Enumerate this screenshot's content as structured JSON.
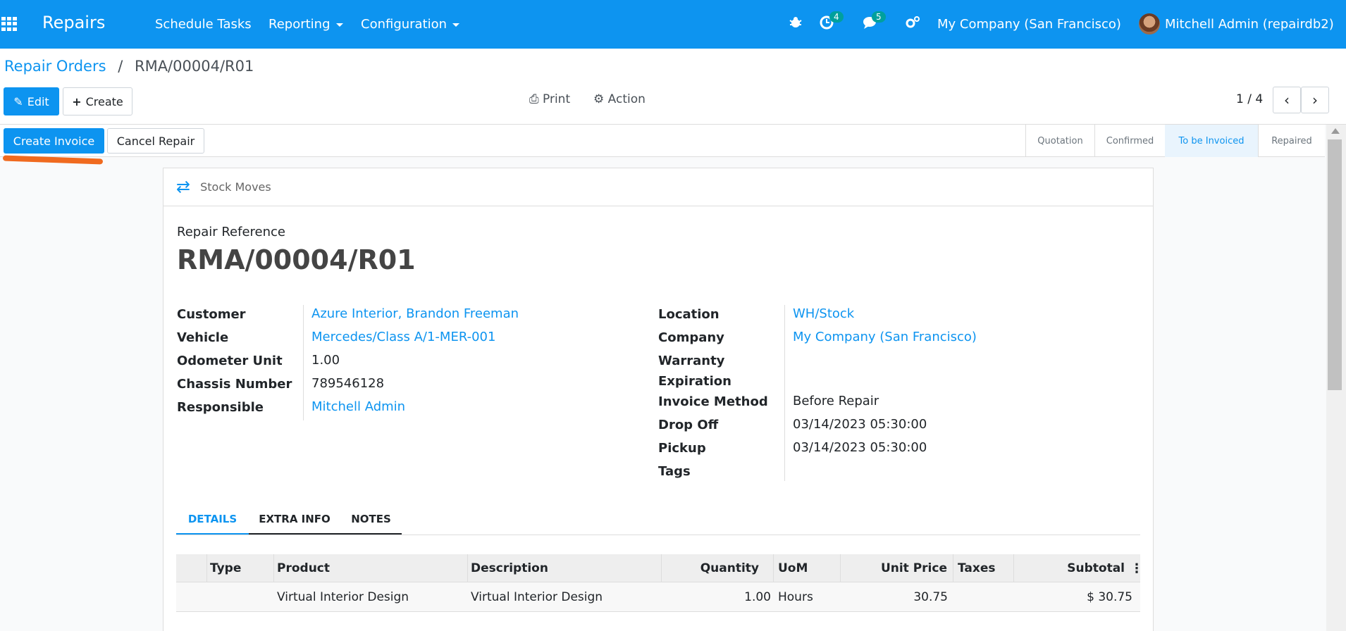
{
  "topbar": {
    "app_title": "Repairs",
    "menu": [
      {
        "label": "Schedule Tasks"
      },
      {
        "label": "Reporting"
      },
      {
        "label": "Configuration"
      }
    ],
    "activity_count": "4",
    "message_count": "5",
    "company": "My Company (San Francisco)",
    "user": "Mitchell Admin (repairdb2)"
  },
  "breadcrumb": {
    "parent": "Repair Orders",
    "separator": "/",
    "current": "RMA/00004/R01"
  },
  "toolbar": {
    "edit_label": "Edit",
    "create_label": "Create",
    "print_label": "Print",
    "action_label": "Action",
    "pager": "1 / 4"
  },
  "status_buttons": {
    "create_invoice": "Create Invoice",
    "cancel_repair": "Cancel Repair"
  },
  "stages": [
    "Quotation",
    "Confirmed",
    "To be Invoiced",
    "Repaired"
  ],
  "active_stage": "To be Invoiced",
  "smart_button": "Stock Moves",
  "form": {
    "reference_label": "Repair Reference",
    "reference": "RMA/00004/R01",
    "left": {
      "customer_label": "Customer",
      "customer": "Azure Interior, Brandon Freeman",
      "vehicle_label": "Vehicle",
      "vehicle": "Mercedes/Class A/1-MER-001",
      "odometer_label": "Odometer Unit",
      "odometer": "1.00",
      "chassis_label": "Chassis Number",
      "chassis": "789546128",
      "responsible_label": "Responsible",
      "responsible": "Mitchell Admin"
    },
    "right": {
      "location_label": "Location",
      "location": "WH/Stock",
      "company_label": "Company",
      "company": "My Company (San Francisco)",
      "warranty_label_1": "Warranty",
      "warranty_label_2": "Expiration",
      "invoice_method_label": "Invoice Method",
      "invoice_method": "Before Repair",
      "drop_off_label": "Drop Off",
      "drop_off": "03/14/2023 05:30:00",
      "pickup_label": "Pickup",
      "pickup": "03/14/2023 05:30:00",
      "tags_label": "Tags"
    }
  },
  "tabs": [
    "DETAILS",
    "EXTRA INFO",
    "NOTES"
  ],
  "table": {
    "headers": [
      "Type",
      "Product",
      "Description",
      "Quantity",
      "UoM",
      "Unit Price",
      "Taxes",
      "Subtotal"
    ],
    "rows": [
      {
        "type": "",
        "product": "Virtual Interior Design",
        "description": "Virtual Interior Design",
        "quantity": "1.00",
        "uom": "Hours",
        "unit_price": "30.75",
        "taxes": "",
        "subtotal": "$ 30.75"
      }
    ]
  }
}
